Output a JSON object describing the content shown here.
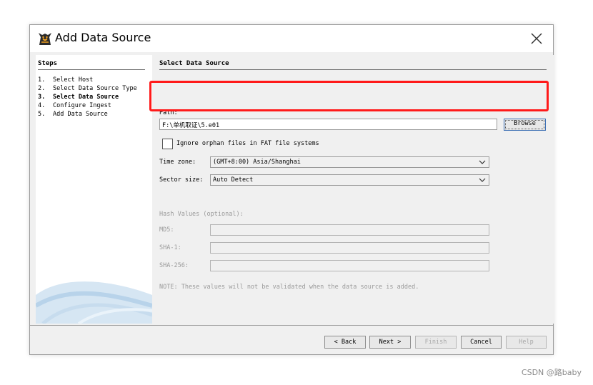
{
  "window": {
    "title": "Add Data Source"
  },
  "steps": {
    "heading": "Steps",
    "items": [
      {
        "num": "1.",
        "label": "Select Host"
      },
      {
        "num": "2.",
        "label": "Select Data Source Type"
      },
      {
        "num": "3.",
        "label": "Select Data Source"
      },
      {
        "num": "4.",
        "label": "Configure Ingest"
      },
      {
        "num": "5.",
        "label": "Add Data Source"
      }
    ]
  },
  "main": {
    "heading": "Select Data Source",
    "path_label": "Path:",
    "path_value": "F:\\单机取证\\5.e01",
    "browse_label": "Browse",
    "orphan_label": "Ignore orphan files in FAT file systems",
    "timezone_label": "Time zone:",
    "timezone_value": "(GMT+8:00) Asia/Shanghai",
    "sector_label": "Sector size:",
    "sector_value": "Auto Detect",
    "hash_heading": "Hash Values (optional):",
    "md5_label": "MD5:",
    "sha1_label": "SHA-1:",
    "sha256_label": "SHA-256:",
    "note": "NOTE: These values will not be validated when the data source is added."
  },
  "footer": {
    "back": "< Back",
    "next": "Next >",
    "finish": "Finish",
    "cancel": "Cancel",
    "help": "Help"
  },
  "watermark": "CSDN @路baby",
  "colors": {
    "highlight": "#ff1a1a",
    "accent": "#3c6fb4"
  }
}
